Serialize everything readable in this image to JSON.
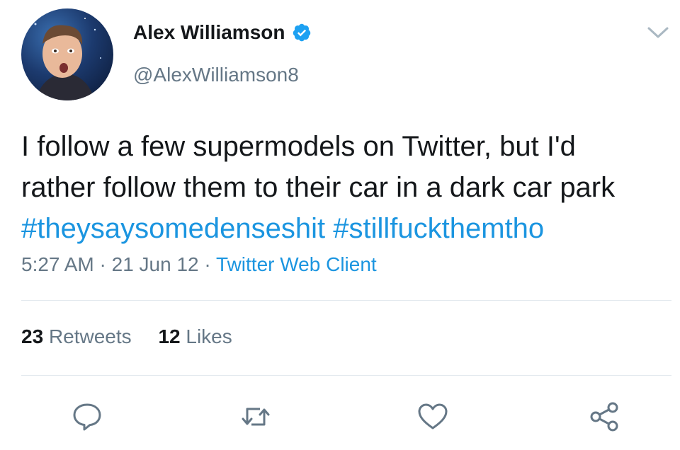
{
  "header": {
    "display_name": "Alex Williamson",
    "handle": "@AlexWilliamson8",
    "verified": true,
    "avatar_icon": "profile-photo",
    "menu_icon": "chevron-down-icon"
  },
  "tweet": {
    "line1": "I follow a few supermodels on Twitter, but I'd",
    "line2": "rather follow them to their car in a dark car park",
    "hashtag1": "#theysaysomedenseshit",
    "hashtag2": "#stillfuckthemtho"
  },
  "meta": {
    "time": "5:27 AM",
    "separator": " · ",
    "date": "21 Jun 12",
    "source": "Twitter Web Client"
  },
  "stats": {
    "retweets_count": "23",
    "retweets_label": "Retweets",
    "likes_count": "12",
    "likes_label": "Likes"
  },
  "actions": {
    "reply_icon": "reply-icon",
    "retweet_icon": "retweet-icon",
    "like_icon": "heart-icon",
    "share_icon": "share-icon"
  },
  "colors": {
    "link": "#1b95e0",
    "secondary_text": "#657786",
    "primary_text": "#14171a",
    "divider": "#e1e8ed"
  }
}
